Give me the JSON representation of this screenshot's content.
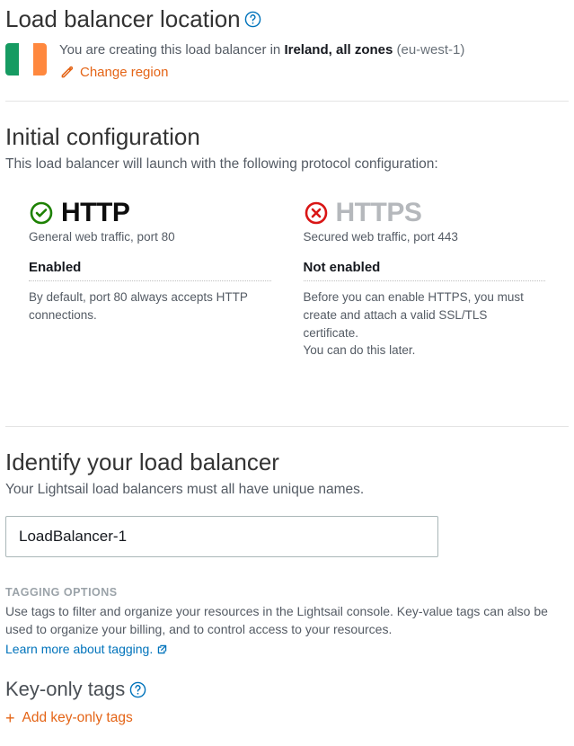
{
  "location": {
    "title": "Load balancer location",
    "intro_prefix": "You are creating this load balancer in ",
    "region_name": "Ireland, all zones",
    "region_code": "(eu-west-1)",
    "change_label": "Change region",
    "flag_colors": {
      "left": "#169b62",
      "middle": "#ffffff",
      "right": "#ff883e"
    }
  },
  "config": {
    "title": "Initial configuration",
    "subtitle": "This load balancer will launch with the following protocol configuration:",
    "http": {
      "name": "HTTP",
      "desc": "General web traffic, port 80",
      "status": "Enabled",
      "help": "By default, port 80 always accepts HTTP connections."
    },
    "https": {
      "name": "HTTPS",
      "desc": "Secured web traffic, port 443",
      "status": "Not enabled",
      "help_line1": "Before you can enable HTTPS, you must create and attach a valid SSL/TLS certificate.",
      "help_line2": "You can do this later."
    }
  },
  "identify": {
    "title": "Identify your load balancer",
    "desc": "Your Lightsail load balancers must all have unique names.",
    "name_value": "LoadBalancer-1"
  },
  "tagging": {
    "label": "TAGGING OPTIONS",
    "desc": "Use tags to filter and organize your resources in the Lightsail console. Key-value tags can also be used to organize your billing, and to control access to your resources.",
    "learn_more": "Learn more about tagging."
  },
  "keyonly": {
    "title": "Key-only tags",
    "add_label": "Add key-only tags"
  },
  "colors": {
    "link_blue": "#0073bb",
    "action_orange": "#e46416",
    "success_green": "#1d8102",
    "error_red": "#d91515"
  }
}
